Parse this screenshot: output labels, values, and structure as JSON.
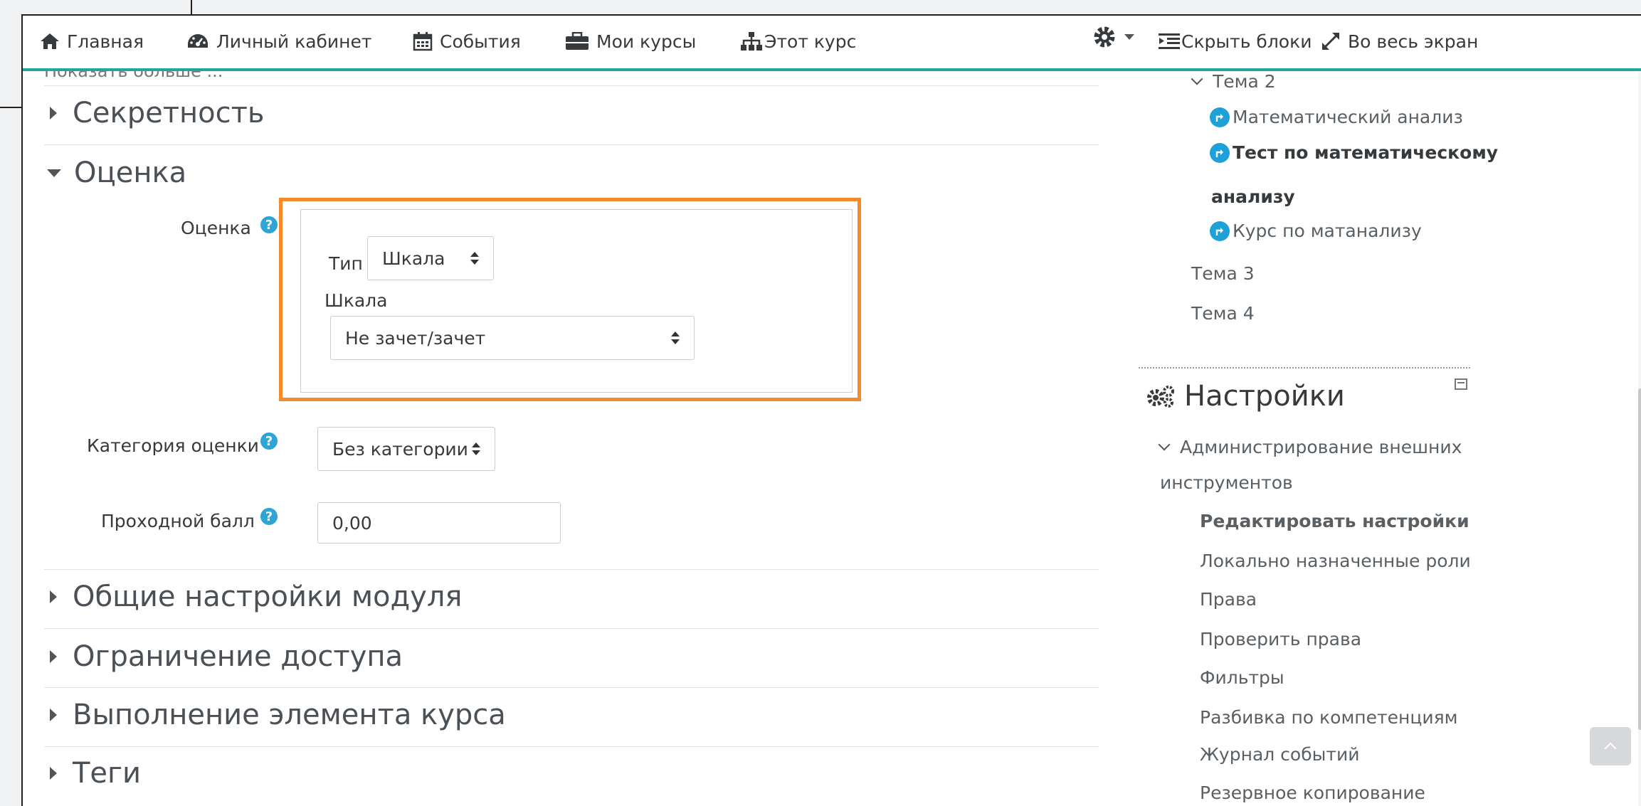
{
  "navbar": {
    "home": "Главная",
    "dashboard": "Личный кабинет",
    "events": "События",
    "my_courses": "Мои курсы",
    "this_course": "Этот курс",
    "hide_blocks": "Скрыть блоки",
    "fullscreen": "Во весь экран"
  },
  "main": {
    "show_more": "Показать больше ...",
    "sections": {
      "privacy": "Секретность",
      "grade": "Оценка",
      "common_module": "Общие настройки модуля",
      "restrict_access": "Ограничение доступа",
      "completion": "Выполнение элемента курса",
      "tags": "Теги"
    },
    "grade_form": {
      "grade_label": "Оценка",
      "type_label": "Тип",
      "type_value": "Шкала",
      "scale_label": "Шкала",
      "scale_value": "Не зачет/зачет",
      "category_label": "Категория оценки",
      "category_value": "Без категории",
      "pass_label": "Проходной балл",
      "pass_value": "0,00"
    }
  },
  "sidebar": {
    "tree": {
      "topic2": "Тема 2",
      "item1": "Математический анализ",
      "item2_line1": "Тест по математическому",
      "item2_line2": "анализу",
      "item3": "Курс по матанализу",
      "topic3": "Тема 3",
      "topic4": "Тема 4"
    },
    "settings_block": {
      "title": "Настройки",
      "admin_line1": "Администрирование внешних",
      "admin_line2": "инструментов",
      "links": [
        "Редактировать настройки",
        "Локально назначенные роли",
        "Права",
        "Проверить права",
        "Фильтры",
        "Разбивка по компетенциям",
        "Журнал событий",
        "Резервное копирование"
      ]
    }
  },
  "colors": {
    "accent": "#1fa89a",
    "highlight": "#f58a2c",
    "help": "#2fa4d6"
  }
}
